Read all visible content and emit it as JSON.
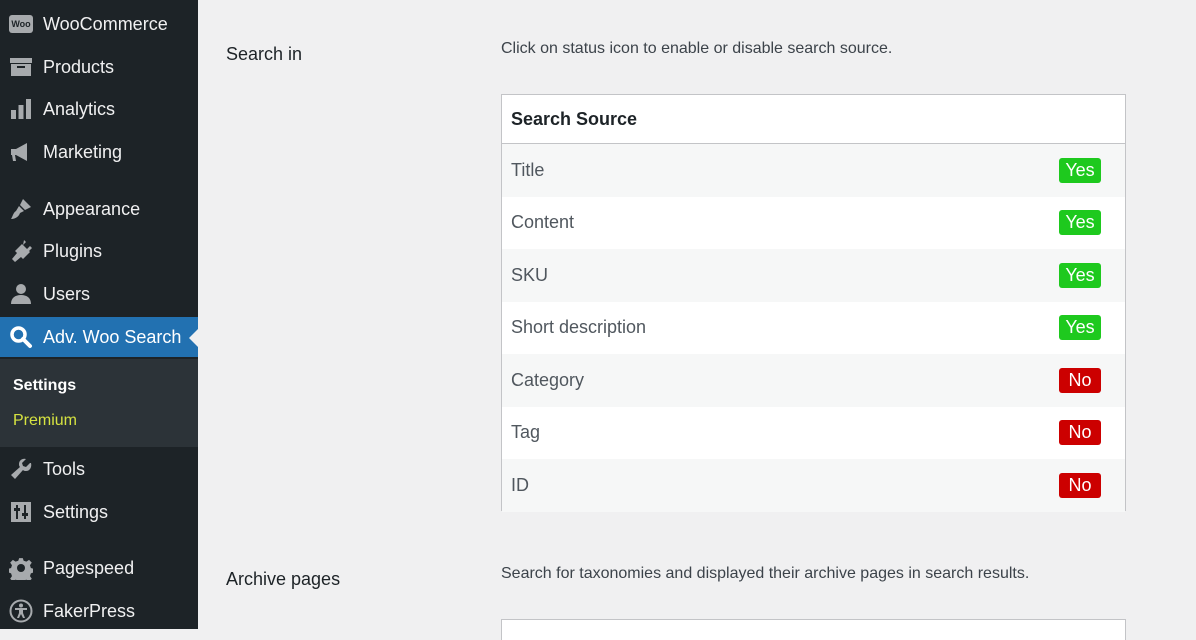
{
  "sidebar": {
    "items": [
      {
        "label": "WooCommerce",
        "icon": "woo-icon"
      },
      {
        "label": "Products",
        "icon": "archive-box-icon"
      },
      {
        "label": "Analytics",
        "icon": "bar-chart-icon"
      },
      {
        "label": "Marketing",
        "icon": "megaphone-icon"
      },
      {
        "label": "Appearance",
        "icon": "paintbrush-icon"
      },
      {
        "label": "Plugins",
        "icon": "plug-icon"
      },
      {
        "label": "Users",
        "icon": "user-icon"
      },
      {
        "label": "Adv. Woo Search",
        "icon": "search-icon",
        "active": true
      },
      {
        "label": "Tools",
        "icon": "wrench-icon"
      },
      {
        "label": "Settings",
        "icon": "sliders-icon"
      },
      {
        "label": "Pagespeed",
        "icon": "gear-icon"
      },
      {
        "label": "FakerPress",
        "icon": "accessibility-icon"
      }
    ],
    "submenu": [
      {
        "label": "Settings",
        "current": true
      },
      {
        "label": "Premium"
      }
    ],
    "woo_logo_text": "Woo"
  },
  "search_in": {
    "label": "Search in",
    "description": "Click on status icon to enable or disable search source.",
    "table_header": "Search Source",
    "rows": [
      {
        "name": "Title",
        "status": "Yes"
      },
      {
        "name": "Content",
        "status": "Yes"
      },
      {
        "name": "SKU",
        "status": "Yes"
      },
      {
        "name": "Short description",
        "status": "Yes"
      },
      {
        "name": "Category",
        "status": "No"
      },
      {
        "name": "Tag",
        "status": "No"
      },
      {
        "name": "ID",
        "status": "No"
      }
    ]
  },
  "archive_pages": {
    "label": "Archive pages",
    "description": "Search for taxonomies and displayed their archive pages in search results."
  },
  "colors": {
    "yes": "#1ec91e",
    "no": "#cc0000",
    "accent": "#2271b1",
    "sidebar_bg": "#1d2327"
  }
}
